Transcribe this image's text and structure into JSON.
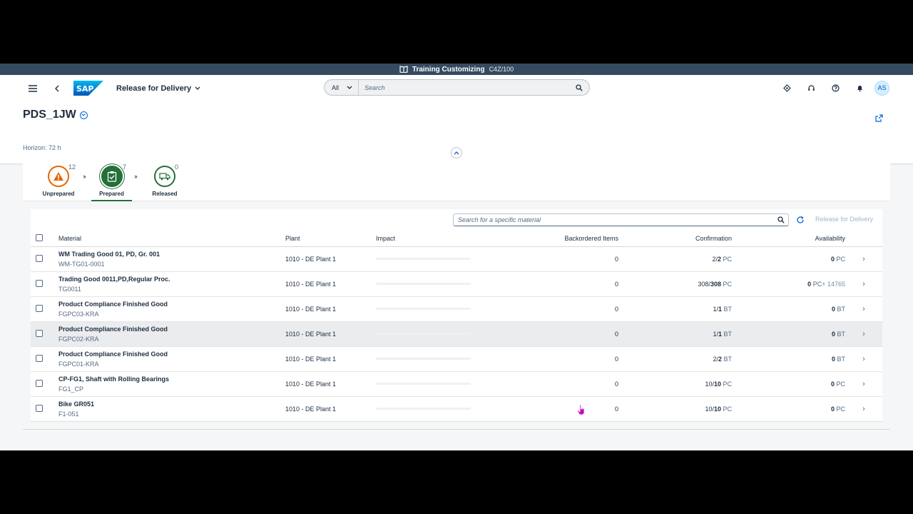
{
  "system_bar": {
    "title": "Training Customizing",
    "client": "C4Z/100"
  },
  "shell": {
    "app_title": "Release for Delivery",
    "search_scope": "All",
    "search_placeholder": "Search",
    "avatar_initials": "AS"
  },
  "header": {
    "object_title": "PDS_1JW",
    "horizon": "Horizon: 72 h"
  },
  "process_flow": {
    "steps": [
      {
        "label": "Unprepared",
        "count": "12",
        "color": "#e76500"
      },
      {
        "label": "Prepared",
        "count": "7",
        "color": "#256f3a"
      },
      {
        "label": "Released",
        "count": "0",
        "color": "#256f3a"
      }
    ]
  },
  "table": {
    "search_placeholder": "Search for a specific material",
    "release_button": "Release for Delivery",
    "columns": {
      "material": "Material",
      "plant": "Plant",
      "impact": "Impact",
      "backordered": "Backordered Items",
      "confirmation": "Confirmation",
      "availability": "Availability"
    },
    "rows": [
      {
        "name": "WM Trading Good 01, PD, Gr. 001",
        "id": "WM-TG01-0001",
        "plant": "1010 - DE Plant 1",
        "backordered": "0",
        "conf_a": "2/",
        "conf_b": "2",
        "conf_unit": " PC",
        "avail": "0",
        "avail_unit": " PC",
        "avail_extra": ""
      },
      {
        "name": "Trading Good 0011,PD,Regular Proc.",
        "id": "TG0011",
        "plant": "1010 - DE Plant 1",
        "backordered": "0",
        "conf_a": "308/",
        "conf_b": "308",
        "conf_unit": " PC",
        "avail": "0",
        "avail_unit": " PC",
        "avail_extra": "+ 14765"
      },
      {
        "name": "Product Compliance Finished Good",
        "id": "FGPC03-KRA",
        "plant": "1010 - DE Plant 1",
        "backordered": "0",
        "conf_a": "1/",
        "conf_b": "1",
        "conf_unit": " BT",
        "avail": "0",
        "avail_unit": " BT",
        "avail_extra": ""
      },
      {
        "name": "Product Compliance Finished Good",
        "id": "FGPC02-KRA",
        "plant": "1010 - DE Plant 1",
        "backordered": "0",
        "conf_a": "1/",
        "conf_b": "1",
        "conf_unit": " BT",
        "avail": "0",
        "avail_unit": " BT",
        "avail_extra": ""
      },
      {
        "name": "Product Compliance Finished Good",
        "id": "FGPC01-KRA",
        "plant": "1010 - DE Plant 1",
        "backordered": "0",
        "conf_a": "2/",
        "conf_b": "2",
        "conf_unit": " BT",
        "avail": "0",
        "avail_unit": " BT",
        "avail_extra": ""
      },
      {
        "name": "CP-FG1, Shaft with Rolling Bearings",
        "id": "FG1_CP",
        "plant": "1010 - DE Plant 1",
        "backordered": "0",
        "conf_a": "10/",
        "conf_b": "10",
        "conf_unit": " PC",
        "avail": "0",
        "avail_unit": " PC",
        "avail_extra": ""
      },
      {
        "name": "Bike GR051",
        "id": "F1-051",
        "plant": "1010 - DE Plant 1",
        "backordered": "0",
        "conf_a": "10/",
        "conf_b": "10",
        "conf_unit": " PC",
        "avail": "0",
        "avail_unit": " PC",
        "avail_extra": ""
      }
    ]
  },
  "colors": {
    "shell_bar": "#354a5f",
    "accent": "#0064d9",
    "success": "#256f3a",
    "warning": "#e76500"
  }
}
